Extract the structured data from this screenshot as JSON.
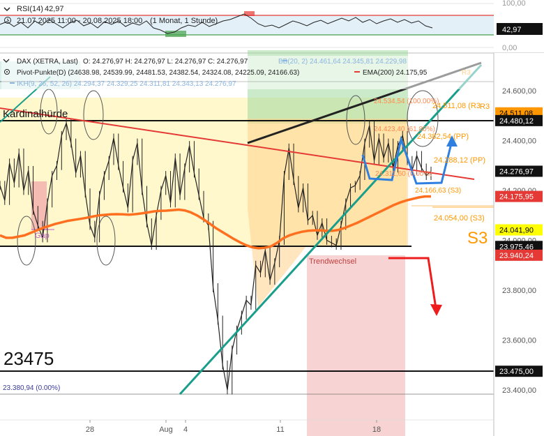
{
  "rsi": {
    "label": "RSI(14)",
    "value": "42,97",
    "range": "21.07.2025 11:00 - 20.08.2025 18:00",
    "period": "(1 Monat, 1 Stunde)",
    "axis_top": "100,00",
    "axis_bottom": "0,00",
    "current": "42,97"
  },
  "legend": {
    "line1": {
      "name": "DAX (XETRA, Last)",
      "ohlc": "O: 24.276,97  H: 24.276,97  L: 24.276,97  C: 24.276,97",
      "bb": "BB(20, 2)  24.461,64  24.345,81  24.229,98"
    },
    "line2": {
      "pivot": "Pivot-Punkte(D)  (24638.98,  24539.99,  24481.53,  24382.54,  24324.08,  24225.09,  24166.63)",
      "ema": "EMA(200)  24.175,95"
    },
    "line3": {
      "ikh": "IKH(9, 26, 52, 26)  24.294,37  24.329,25  24.311,81  24.343,13  24.276,97"
    }
  },
  "annotations": {
    "kardinal": "Kardinalhürde",
    "gap": "Gap",
    "trendwechsel": "Trendwechsel",
    "big_level": "23475",
    "low_label": "23.380,94 (0.00%)",
    "s3_big": "S3",
    "pivot_r3": "24.511,08 (R3",
    "pivot_100": "24.534,54 (100.00%)",
    "pivot_618": "24.423,40 (61.80%)",
    "pivot_pp1": "24.382,54 (PP)",
    "pivot_pp2": "24.288,12 (PP)",
    "pivot_s3a": "24.166,63 (S3)",
    "pivot_s3b": "24.054,00 (S3)",
    "pivot_r3_top": "R3",
    "pivot_0": "24.311,60 (0.00%)",
    "r3_small": "R3"
  },
  "price_tags": [
    {
      "text": "24.511,08",
      "bg": "#ff9800",
      "fg": "#000000"
    },
    {
      "text": "24.480,12",
      "bg": "#111111",
      "fg": "#ffffff"
    },
    {
      "text": "24.276,97",
      "bg": "#111111",
      "fg": "#ffffff"
    },
    {
      "text": "24.175,95",
      "bg": "#e53935",
      "fg": "#ffffff"
    },
    {
      "text": "24.041,90",
      "bg": "#ffff00",
      "fg": "#000000"
    },
    {
      "text": "23.975,46",
      "bg": "#111111",
      "fg": "#ffffff"
    },
    {
      "text": "23.940,24",
      "bg": "#e53935",
      "fg": "#ffffff"
    },
    {
      "text": "23.475,00",
      "bg": "#111111",
      "fg": "#ffffff"
    }
  ],
  "chart_data": {
    "type": "line",
    "title": "DAX (XETRA, Last)",
    "yaxis_ticks": [
      "24.600,00",
      "24.400,00",
      "24.200,00",
      "24.000,00",
      "23.800,00",
      "23.600,00",
      "23.400,00"
    ],
    "xaxis_ticks": [
      "28",
      "Aug",
      "4",
      "11",
      "18"
    ],
    "ylim": [
      23350,
      24750
    ],
    "colors": {
      "price": "#222222",
      "ema": "#ff6f20",
      "trend_red": "#e53935",
      "trend_green": "#1a9e8c",
      "arrow_blue": "#2f7fe0",
      "arrow_red": "#ee1c1c"
    },
    "series": [
      {
        "name": "DAX (XETRA, Last)",
        "values": [
          24220,
          24160,
          24310,
          24230,
          24350,
          24200,
          24280,
          24120,
          24060,
          24010,
          24150,
          24260,
          24300,
          24420,
          24470,
          24390,
          24270,
          24340,
          24190,
          24060,
          24010,
          24180,
          24260,
          24320,
          24410,
          24300,
          24210,
          24130,
          24320,
          24390,
          24200,
          24070,
          23980,
          24100,
          24200,
          24260,
          24150,
          24330,
          24180,
          24290,
          24380,
          24270,
          24180,
          24090,
          24060,
          23810,
          23680,
          23500,
          23400,
          23560,
          23640,
          23700,
          23760,
          23740,
          23900,
          23870,
          23960,
          23840,
          23910,
          24000,
          24260,
          24370,
          24240,
          24130,
          24210,
          24080,
          24100,
          24020,
          24070,
          24000,
          23990,
          23980,
          24060,
          24150,
          24210,
          24220,
          24260,
          24390,
          24460,
          24320,
          24410,
          24330,
          24390,
          24290,
          24380,
          24420,
          24320,
          24280,
          24340,
          24290,
          24260,
          24277
        ]
      },
      {
        "name": "EMA(200)",
        "values": [
          24020,
          24010,
          24010,
          24015,
          24020,
          24030,
          24040,
          24050,
          24058,
          24066,
          24072,
          24078,
          24082,
          24086,
          24090,
          24095,
          24100,
          24102,
          24104,
          24105,
          24104,
          24103,
          24105,
          24108,
          24112,
          24116,
          24118,
          24119,
          24121,
          24123,
          24120,
          24112,
          24100,
          24085,
          24068,
          24050,
          24035,
          24020,
          24005,
          23992,
          23980,
          23972,
          23968,
          23970,
          23976,
          23990,
          24008,
          24020,
          24028,
          24034,
          24038,
          24040,
          24040,
          24038,
          24038,
          24042,
          24050,
          24060,
          24070,
          24082,
          24094,
          24106,
          24118,
          24130,
          24142,
          24152,
          24160,
          24166,
          24172,
          24176,
          24176
        ]
      }
    ]
  }
}
